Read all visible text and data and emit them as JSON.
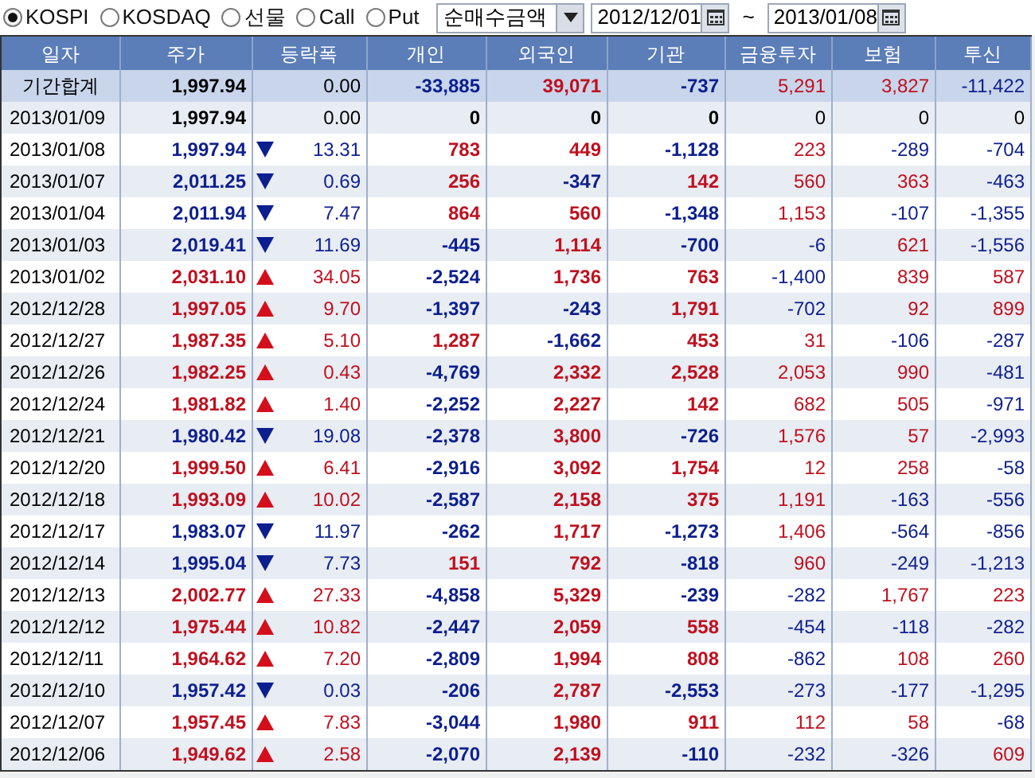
{
  "toolbar": {
    "markets": [
      {
        "label": "KOSPI",
        "selected": true
      },
      {
        "label": "KOSDAQ",
        "selected": false
      },
      {
        "label": "선물",
        "selected": false
      },
      {
        "label": "Call",
        "selected": false
      },
      {
        "label": "Put",
        "selected": false
      }
    ],
    "measure": {
      "value": "순매수금액"
    },
    "date_from": {
      "value": "2012/12/01"
    },
    "separator": "~",
    "date_to": {
      "value": "2013/01/08"
    }
  },
  "table": {
    "columns": [
      "일자",
      "주가",
      "등락폭",
      "개인",
      "외국인",
      "기관",
      "금융투자",
      "보험",
      "투신"
    ],
    "rows": [
      {
        "kind": "summary",
        "date": "기간합계",
        "price": "1,997.94",
        "rising": false,
        "falling": false,
        "change": "0.00",
        "flows": [
          "-33,885",
          "39,071",
          "-737",
          "5,291",
          "3,827",
          "-11,422"
        ]
      },
      {
        "kind": "day",
        "date": "2013/01/09",
        "price": "1,997.94",
        "rising": false,
        "falling": false,
        "change": "0.00",
        "flows": [
          "0",
          "0",
          "0",
          "0",
          "0",
          "0"
        ]
      },
      {
        "kind": "day",
        "date": "2013/01/08",
        "price": "1,997.94",
        "rising": false,
        "falling": true,
        "change": "13.31",
        "flows": [
          "783",
          "449",
          "-1,128",
          "223",
          "-289",
          "-704"
        ]
      },
      {
        "kind": "day",
        "date": "2013/01/07",
        "price": "2,011.25",
        "rising": false,
        "falling": true,
        "change": "0.69",
        "flows": [
          "256",
          "-347",
          "142",
          "560",
          "363",
          "-463"
        ]
      },
      {
        "kind": "day",
        "date": "2013/01/04",
        "price": "2,011.94",
        "rising": false,
        "falling": true,
        "change": "7.47",
        "flows": [
          "864",
          "560",
          "-1,348",
          "1,153",
          "-107",
          "-1,355"
        ]
      },
      {
        "kind": "day",
        "date": "2013/01/03",
        "price": "2,019.41",
        "rising": false,
        "falling": true,
        "change": "11.69",
        "flows": [
          "-445",
          "1,114",
          "-700",
          "-6",
          "621",
          "-1,556"
        ]
      },
      {
        "kind": "day",
        "date": "2013/01/02",
        "price": "2,031.10",
        "rising": true,
        "falling": false,
        "change": "34.05",
        "flows": [
          "-2,524",
          "1,736",
          "763",
          "-1,400",
          "839",
          "587"
        ]
      },
      {
        "kind": "day",
        "date": "2012/12/28",
        "price": "1,997.05",
        "rising": true,
        "falling": false,
        "change": "9.70",
        "flows": [
          "-1,397",
          "-243",
          "1,791",
          "-702",
          "92",
          "899"
        ]
      },
      {
        "kind": "day",
        "date": "2012/12/27",
        "price": "1,987.35",
        "rising": true,
        "falling": false,
        "change": "5.10",
        "flows": [
          "1,287",
          "-1,662",
          "453",
          "31",
          "-106",
          "-287"
        ]
      },
      {
        "kind": "day",
        "date": "2012/12/26",
        "price": "1,982.25",
        "rising": true,
        "falling": false,
        "change": "0.43",
        "flows": [
          "-4,769",
          "2,332",
          "2,528",
          "2,053",
          "990",
          "-481"
        ]
      },
      {
        "kind": "day",
        "date": "2012/12/24",
        "price": "1,981.82",
        "rising": true,
        "falling": false,
        "change": "1.40",
        "flows": [
          "-2,252",
          "2,227",
          "142",
          "682",
          "505",
          "-971"
        ]
      },
      {
        "kind": "day",
        "date": "2012/12/21",
        "price": "1,980.42",
        "rising": false,
        "falling": true,
        "change": "19.08",
        "flows": [
          "-2,378",
          "3,800",
          "-726",
          "1,576",
          "57",
          "-2,993"
        ]
      },
      {
        "kind": "day",
        "date": "2012/12/20",
        "price": "1,999.50",
        "rising": true,
        "falling": false,
        "change": "6.41",
        "flows": [
          "-2,916",
          "3,092",
          "1,754",
          "12",
          "258",
          "-58"
        ]
      },
      {
        "kind": "day",
        "date": "2012/12/18",
        "price": "1,993.09",
        "rising": true,
        "falling": false,
        "change": "10.02",
        "flows": [
          "-2,587",
          "2,158",
          "375",
          "1,191",
          "-163",
          "-556"
        ]
      },
      {
        "kind": "day",
        "date": "2012/12/17",
        "price": "1,983.07",
        "rising": false,
        "falling": true,
        "change": "11.97",
        "flows": [
          "-262",
          "1,717",
          "-1,273",
          "1,406",
          "-564",
          "-856"
        ]
      },
      {
        "kind": "day",
        "date": "2012/12/14",
        "price": "1,995.04",
        "rising": false,
        "falling": true,
        "change": "7.73",
        "flows": [
          "151",
          "792",
          "-818",
          "960",
          "-249",
          "-1,213"
        ]
      },
      {
        "kind": "day",
        "date": "2012/12/13",
        "price": "2,002.77",
        "rising": true,
        "falling": false,
        "change": "27.33",
        "flows": [
          "-4,858",
          "5,329",
          "-239",
          "-282",
          "1,767",
          "223"
        ]
      },
      {
        "kind": "day",
        "date": "2012/12/12",
        "price": "1,975.44",
        "rising": true,
        "falling": false,
        "change": "10.82",
        "flows": [
          "-2,447",
          "2,059",
          "558",
          "-454",
          "-118",
          "-282"
        ]
      },
      {
        "kind": "day",
        "date": "2012/12/11",
        "price": "1,964.62",
        "rising": true,
        "falling": false,
        "change": "7.20",
        "flows": [
          "-2,809",
          "1,994",
          "808",
          "-862",
          "108",
          "260"
        ]
      },
      {
        "kind": "day",
        "date": "2012/12/10",
        "price": "1,957.42",
        "rising": false,
        "falling": true,
        "change": "0.03",
        "flows": [
          "-206",
          "2,787",
          "-2,553",
          "-273",
          "-177",
          "-1,295"
        ]
      },
      {
        "kind": "day",
        "date": "2012/12/07",
        "price": "1,957.45",
        "rising": true,
        "falling": false,
        "change": "7.83",
        "flows": [
          "-3,044",
          "1,980",
          "911",
          "112",
          "58",
          "-68"
        ]
      },
      {
        "kind": "day",
        "date": "2012/12/06",
        "price": "1,949.62",
        "rising": true,
        "falling": false,
        "change": "2.58",
        "flows": [
          "-2,070",
          "2,139",
          "-110",
          "-232",
          "-326",
          "609"
        ]
      }
    ]
  }
}
